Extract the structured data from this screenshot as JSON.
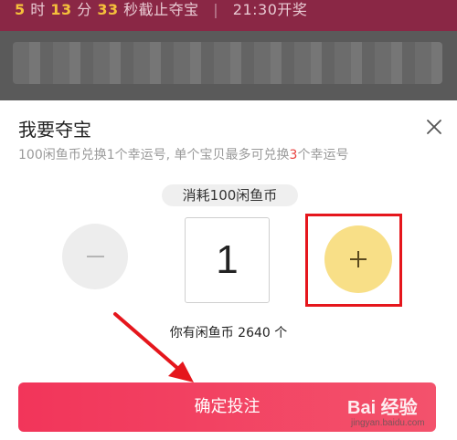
{
  "banner": {
    "seg1_num": "5",
    "seg1_unit": "时",
    "seg2_num": "13",
    "seg2_unit": "分",
    "seg3_num": "33",
    "seg3_unit": "秒截止夺宝",
    "separator": "|",
    "draw_time": "21:30开奖"
  },
  "sheet": {
    "title": "我要夺宝",
    "subtitle_prefix": "100闲鱼币兑换1个幸运号, 单个宝贝最多可兑换",
    "subtitle_max": "3",
    "subtitle_suffix": "个幸运号",
    "close_icon": "close-icon"
  },
  "stepper": {
    "cost_label": "消耗100闲鱼币",
    "quantity": "1",
    "minus_icon": "minus-icon",
    "plus_icon": "plus-icon"
  },
  "balance": {
    "text": "你有闲鱼币 2640 个"
  },
  "confirm": {
    "label": "确定投注"
  },
  "watermark": {
    "logo": "Bai 经验",
    "url": "jingyan.baidu.com"
  },
  "colors": {
    "accent": "#f2355a",
    "plus_button": "#f8df87",
    "highlight": "#e5161c",
    "subtitle_max": "#e8423f"
  }
}
